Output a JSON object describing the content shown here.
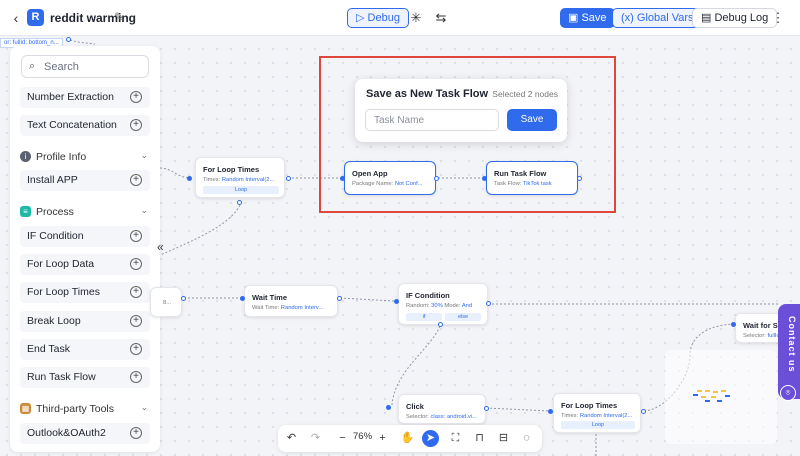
{
  "header": {
    "app_badge": "R",
    "title": "reddit warming",
    "debug_label": "Debug",
    "save_label": "Save",
    "global_vars_label": "Global Vars",
    "debug_log_label": "Debug Log"
  },
  "canvas": {
    "top_tag": "or: fullId: bottom_n..."
  },
  "sidebar": {
    "search_placeholder": "Search",
    "items": [
      {
        "label": "Number Extraction"
      },
      {
        "label": "Text Concatenation"
      }
    ],
    "profile_section": {
      "title": "Profile Info",
      "items": [
        {
          "label": "Install APP"
        }
      ]
    },
    "process_section": {
      "title": "Process",
      "items": [
        {
          "label": "IF Condition"
        },
        {
          "label": "For Loop Data"
        },
        {
          "label": "For Loop Times"
        },
        {
          "label": "Break Loop"
        },
        {
          "label": "End Task"
        },
        {
          "label": "Run Task Flow"
        }
      ]
    },
    "third_party_section": {
      "title": "Third-party Tools",
      "items": [
        {
          "label": "Outlook&OAuth2"
        }
      ]
    }
  },
  "popup": {
    "title": "Save as New Task Flow",
    "selected_note": "Selected 2 nodes",
    "placeholder": "Task Name",
    "button_label": "Save"
  },
  "nodes": {
    "for_loop_times_1": {
      "title": "For Loop Times",
      "key": "Times:",
      "value": "Random Interval(2...",
      "chip": "Loop"
    },
    "open_app": {
      "title": "Open App",
      "key": "Package Name:",
      "value": "Not Conf..."
    },
    "run_task_flow": {
      "title": "Run Task Flow",
      "key": "Task Flow:",
      "value": "TikTok task"
    },
    "partial_left": {
      "text": "8..."
    },
    "wait_time": {
      "title": "Wait Time",
      "key": "Wait Time:",
      "value": "Random Interv..."
    },
    "if_condition": {
      "title": "IF Condition",
      "key": "Random:",
      "value": "30%",
      "key2": "Mode:",
      "value2": "And",
      "chip_if": "if",
      "chip_else": "else"
    },
    "wait_for_sel": {
      "title": "Wait for Selec",
      "key": "Selector:",
      "value": "fullId"
    },
    "click": {
      "title": "Click",
      "key": "Selector:",
      "value": "class: android.vi..."
    },
    "for_loop_times_2": {
      "title": "For Loop Times",
      "key": "Times:",
      "value": "Random Interval(2...",
      "chip": "Loop"
    }
  },
  "toolbar": {
    "zoom": "76%"
  },
  "contact": {
    "label": "Contact us"
  }
}
